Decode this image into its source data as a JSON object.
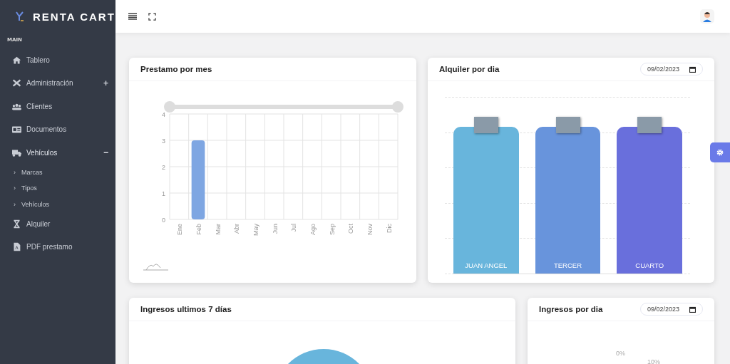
{
  "brand": {
    "name": "RENTA CART"
  },
  "sidebar": {
    "section": "MAIN",
    "items": [
      {
        "label": "Tablero"
      },
      {
        "label": "Administración",
        "toggle": "+",
        "expanded": false
      },
      {
        "label": "Clientes"
      },
      {
        "label": "Documentos"
      },
      {
        "label": "Vehículos",
        "toggle": "−",
        "expanded": true,
        "children": [
          {
            "label": "Marcas",
            "bullet": "›"
          },
          {
            "label": "Tipos",
            "bullet": "›"
          },
          {
            "label": "Vehículos",
            "bullet": "›"
          }
        ]
      },
      {
        "label": "Alquiler"
      },
      {
        "label": "PDF prestamo"
      }
    ]
  },
  "cards": [
    {
      "kind": "monthly",
      "title": "Prestamo por mes",
      "chart_data": {
        "type": "bar",
        "categories": [
          "Ene",
          "Feb",
          "Mar",
          "Abr",
          "May",
          "Jun",
          "Jul",
          "Ago",
          "Sep",
          "Oct",
          "Nov",
          "Dic"
        ],
        "values": [
          0,
          3,
          0,
          0,
          0,
          0,
          0,
          0,
          0,
          0,
          0,
          0
        ],
        "ylim": [
          0,
          4
        ],
        "yticks": [
          0,
          1,
          2,
          3,
          4
        ],
        "grid": true
      }
    },
    {
      "kind": "daily",
      "title": "Alquiler por dia",
      "date": "09/02/2023",
      "bars": [
        {
          "label": "JUAN ANGEL",
          "color": "#68b5dc"
        },
        {
          "label": "TERCER",
          "color": "#6894dc"
        },
        {
          "label": "CUARTO",
          "color": "#696fdc"
        }
      ]
    },
    {
      "kind": "pie",
      "title": "Ingresos ultimos 7 días"
    },
    {
      "kind": "percent",
      "title": "Ingresos por dia",
      "date": "09/02/2023",
      "labels": [
        "0%",
        "10%"
      ]
    }
  ]
}
